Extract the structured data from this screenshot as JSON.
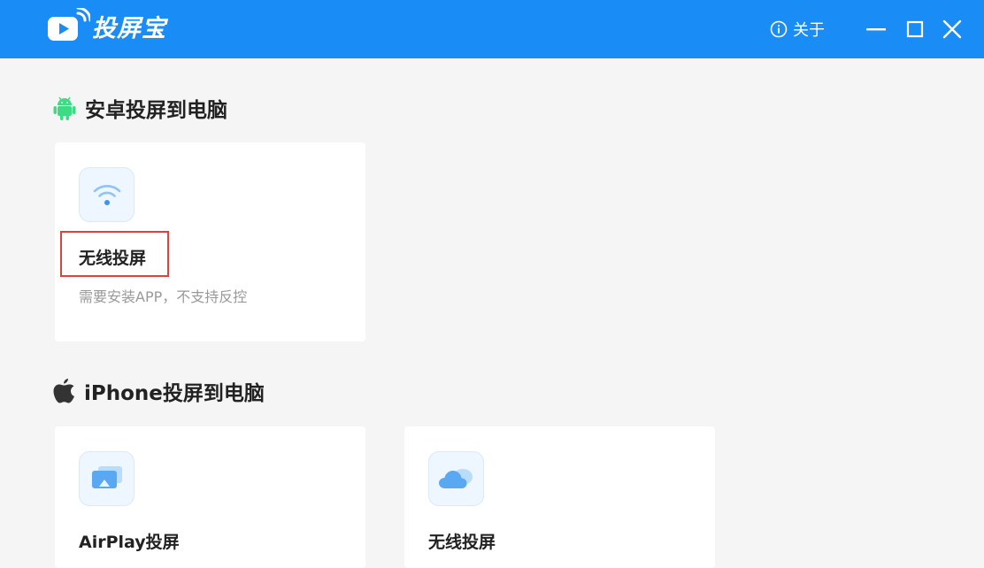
{
  "app": {
    "title": "投屏宝",
    "about_label": "关于"
  },
  "colors": {
    "header_bg": "#1a8cf5",
    "android_green": "#3ddc84",
    "highlight_red": "#d9443c"
  },
  "sections": [
    {
      "title": "安卓投屏到电脑",
      "icon": "android-icon",
      "cards": [
        {
          "title": "无线投屏",
          "desc": "需要安装APP，不支持反控",
          "icon": "wifi-icon"
        }
      ]
    },
    {
      "title": "iPhone投屏到电脑",
      "icon": "apple-icon",
      "cards": [
        {
          "title": "AirPlay投屏",
          "icon": "airplay-icon"
        },
        {
          "title": "无线投屏",
          "icon": "cloud-icon"
        }
      ]
    }
  ]
}
